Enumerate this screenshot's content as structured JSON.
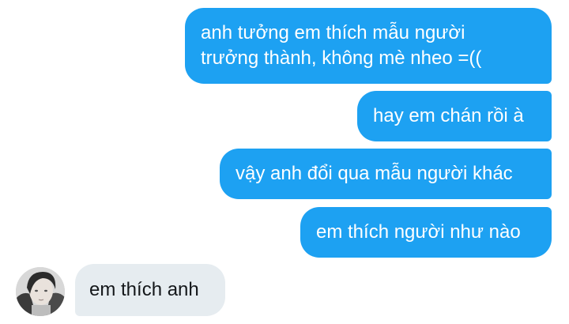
{
  "conversation": {
    "messages": [
      {
        "direction": "sent",
        "lines": [
          "anh tưởng em thích mẫu người",
          "trưởng thành, không mè nheo =(("
        ]
      },
      {
        "direction": "sent",
        "text": "hay em chán rồi à"
      },
      {
        "direction": "sent",
        "text": "vậy anh đổi qua mẫu người khác"
      },
      {
        "direction": "sent",
        "text": "em thích người như nào"
      },
      {
        "direction": "received",
        "text": "em thích anh"
      }
    ]
  },
  "colors": {
    "sent_bubble": "#1da1f2",
    "received_bubble": "#e6ecf0",
    "background": "#ffffff"
  },
  "icons": {
    "avatar": "user-avatar-photo"
  }
}
